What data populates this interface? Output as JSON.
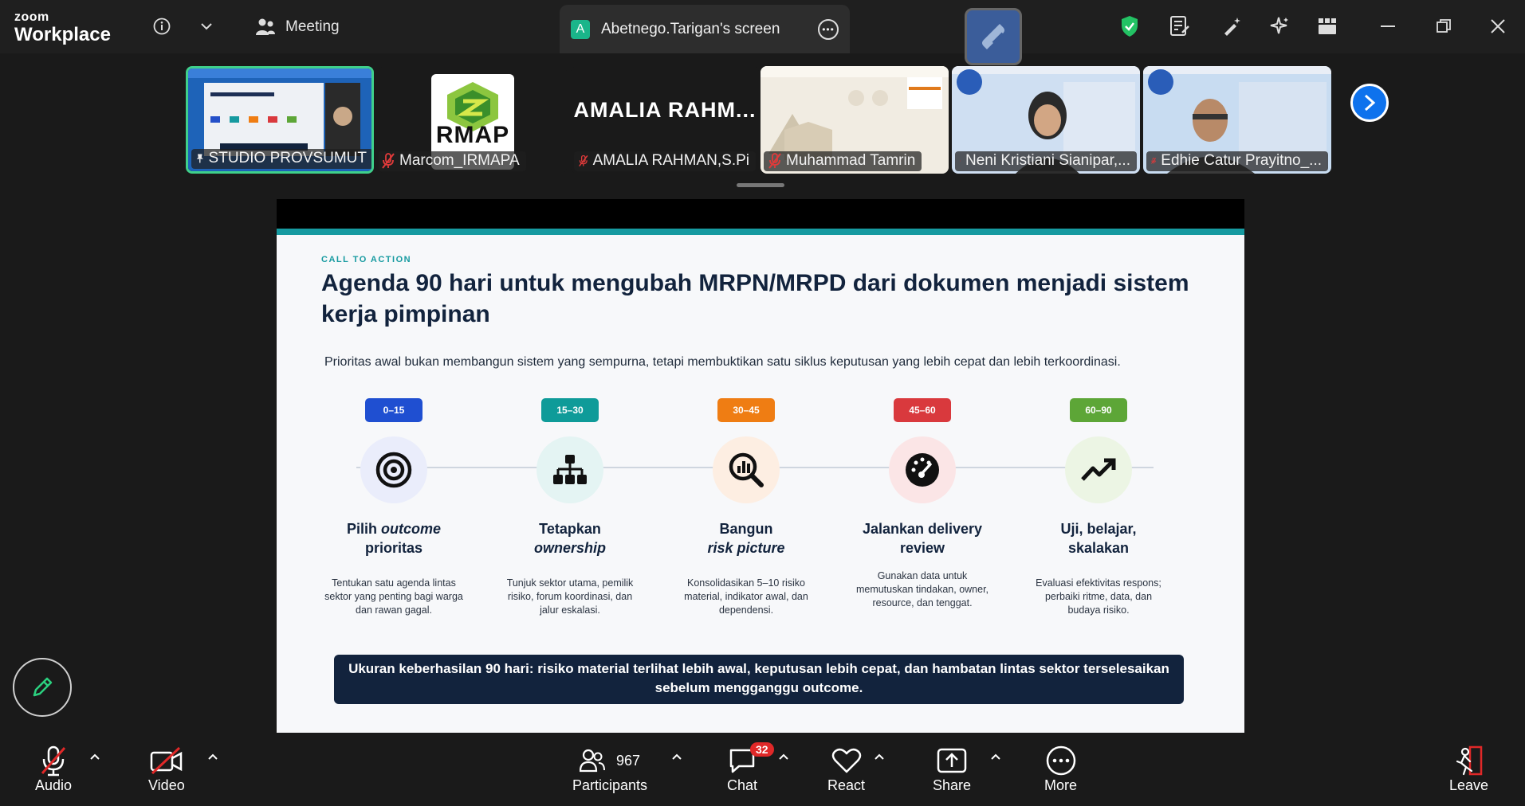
{
  "app": {
    "brand_top": "zoom",
    "brand_bottom": "Workplace"
  },
  "titlebar": {
    "meeting_label": "Meeting",
    "share_tab_avatar": "A",
    "share_tab_label": "Abetnego.Tarigan's screen"
  },
  "gallery": {
    "tiles": [
      {
        "name": "STUDIO PROVSUMUT"
      },
      {
        "name": "Marcom_IRMAPA"
      },
      {
        "name": "AMALIA RAHMAN,S.Pi",
        "display_name": "AMALIA  RAHM..."
      },
      {
        "name": "Muhammad Tamrin"
      },
      {
        "name": "Neni Kristiani Sianipar,..."
      },
      {
        "name": "Edhie Catur Prayitno_..."
      }
    ],
    "logo_text": "RMAP"
  },
  "slide": {
    "kicker": "CALL TO ACTION",
    "title": "Agenda 90 hari untuk mengubah MRPN/MRPD dari dokumen menjadi sistem kerja pimpinan",
    "subtitle": "Prioritas awal bukan membangun sistem yang sempurna, tetapi membuktikan satu siklus keputusan yang lebih cepat dan lebih terkoordinasi.",
    "steps": [
      {
        "range": "0–15",
        "title_a": "Pilih",
        "title_b": "outcome",
        "title_c": "prioritas",
        "desc": "Tentukan satu agenda lintas sektor yang penting bagi warga dan rawan gagal."
      },
      {
        "range": "15–30",
        "title_a": "Tetapkan",
        "title_b": "ownership",
        "title_c": "",
        "desc": "Tunjuk sektor utama, pemilik risiko, forum koordinasi, dan jalur eskalasi."
      },
      {
        "range": "30–45",
        "title_a": "Bangun",
        "title_b": "risk picture",
        "title_c": "",
        "desc": "Konsolidasikan 5–10 risiko material, indikator awal, dan dependensi."
      },
      {
        "range": "45–60",
        "title_a": "Jalankan delivery review",
        "title_b": "",
        "title_c": "",
        "desc": "Gunakan data untuk memutuskan tindakan, owner, resource, dan tenggat."
      },
      {
        "range": "60–90",
        "title_a": "Uji, belajar, skalakan",
        "title_b": "",
        "title_c": "",
        "desc": "Evaluasi efektivitas respons; perbaiki ritme, data, dan budaya risiko."
      }
    ],
    "callout": "Ukuran keberhasilan 90 hari: risiko material terlihat lebih awal, keputusan lebih cepat, dan hambatan lintas sektor terselesaikan sebelum mengganggu outcome."
  },
  "toolbar": {
    "audio": "Audio",
    "video": "Video",
    "participants": "Participants",
    "participant_count": "967",
    "chat": "Chat",
    "chat_badge": "32",
    "react": "React",
    "share": "Share",
    "more": "More",
    "leave": "Leave"
  },
  "colors": {
    "accent_teal": "#169aa0",
    "navy": "#12233d",
    "badge_blue": "#1f4fd1",
    "badge_teal": "#0f9b99",
    "badge_orange": "#ef7d13",
    "badge_red": "#d9393d",
    "badge_green": "#5da637",
    "leave_red": "#e02828"
  }
}
